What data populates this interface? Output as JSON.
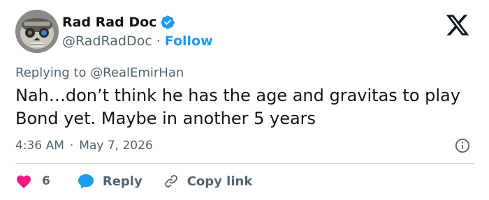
{
  "author": {
    "display_name": "Rad Rad Doc",
    "handle": "@RadRadDoc",
    "separator": "·",
    "follow_label": "Follow",
    "verified_color": "#1d9bf0"
  },
  "tweet": {
    "reply_prefix": "Replying to",
    "reply_mention": "@RealEmirHan",
    "text": "Nah…don’t think he has the age and gravitas to play Bond yet. Maybe in another 5 years",
    "time": "4:36 AM",
    "date": "May 7, 2026",
    "meta_separator": "·"
  },
  "actions": {
    "like_count": "6",
    "reply_label": "Reply",
    "copy_label": "Copy link"
  },
  "icons": {
    "brand": "x-logo-icon",
    "info": "info-icon",
    "like": "heart-icon",
    "reply": "speech-bubble-icon",
    "copy": "link-icon"
  },
  "colors": {
    "like": "#f91880",
    "reply": "#1d9bf0",
    "secondary_text": "#536471",
    "link": "#1d9bf0"
  }
}
